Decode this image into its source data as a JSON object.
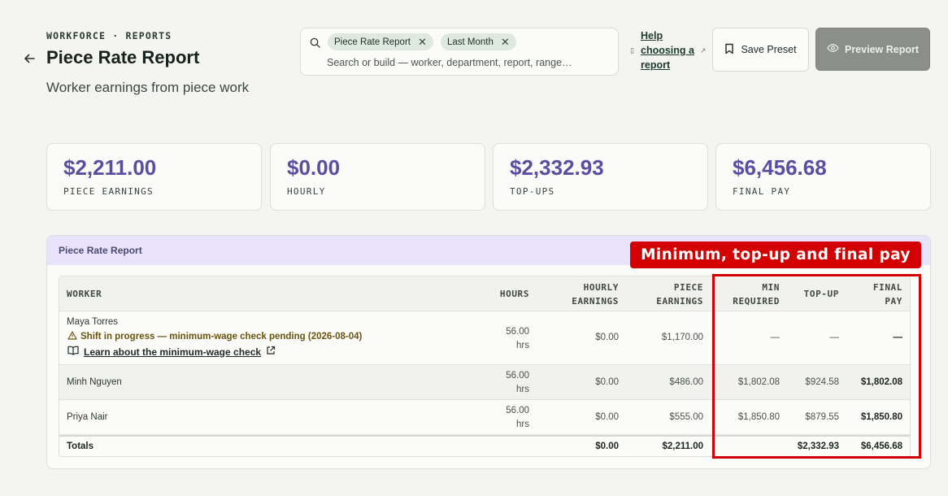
{
  "header": {
    "eyebrow": "WORKFORCE · REPORTS",
    "title": "Piece Rate Report",
    "subtitle": "Worker earnings from piece work"
  },
  "search": {
    "chips": [
      "Piece Rate Report",
      "Last Month"
    ],
    "placeholder": "Search or build — worker, department, report, range…"
  },
  "help": {
    "label": "Help choosing a report"
  },
  "buttons": {
    "save": "Save Preset",
    "preview": "Preview Report"
  },
  "stats": [
    {
      "value": "$2,211.00",
      "label": "PIECE EARNINGS"
    },
    {
      "value": "$0.00",
      "label": "HOURLY"
    },
    {
      "value": "$2,332.93",
      "label": "TOP-UPS"
    },
    {
      "value": "$6,456.68",
      "label": "FINAL PAY"
    }
  ],
  "report": {
    "panel_title": "Piece Rate Report",
    "columns": {
      "worker": "WORKER",
      "hours": "HOURS",
      "hourly": [
        "HOURLY",
        "EARNINGS"
      ],
      "piece": [
        "PIECE",
        "EARNINGS"
      ],
      "min": [
        "MIN",
        "REQUIRED"
      ],
      "topup": "TOP-UP",
      "final": [
        "FINAL",
        "PAY"
      ]
    },
    "rows": [
      {
        "worker": "Maya Torres",
        "warning": "Shift in progress — minimum-wage check pending (2026-08-04)",
        "link": "Learn about the minimum-wage check",
        "hours": "56.00",
        "hours_unit": "hrs",
        "hourly": "$0.00",
        "piece": "$1,170.00",
        "min": "—",
        "topup": "—",
        "final": "—"
      },
      {
        "worker": "Minh Nguyen",
        "hours": "56.00",
        "hours_unit": "hrs",
        "hourly": "$0.00",
        "piece": "$486.00",
        "min": "$1,802.08",
        "topup": "$924.58",
        "final": "$1,802.08"
      },
      {
        "worker": "Priya Nair",
        "hours": "56.00",
        "hours_unit": "hrs",
        "hourly": "$0.00",
        "piece": "$555.00",
        "min": "$1,850.80",
        "topup": "$879.55",
        "final": "$1,850.80"
      }
    ],
    "totals": {
      "label": "Totals",
      "hourly": "$0.00",
      "piece": "$2,211.00",
      "topup": "$2,332.93",
      "final": "$6,456.68"
    }
  },
  "annotation": {
    "label": "Minimum, top-up and final pay",
    "color": "#d20000"
  },
  "colors": {
    "accent": "#5a4ea0",
    "warning": "#6a5510",
    "panel_header": "#e8e3fb"
  }
}
